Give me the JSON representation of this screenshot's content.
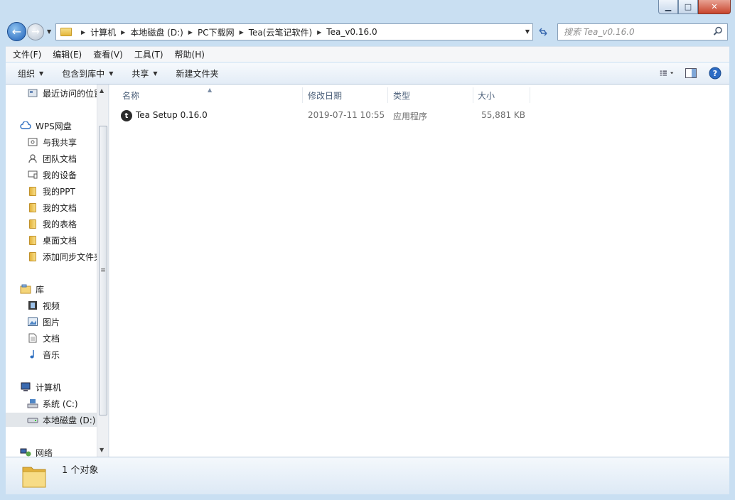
{
  "window": {
    "caption": {
      "minimize": "▁",
      "maximize": "□",
      "close": "✕"
    }
  },
  "address_bar": {
    "breadcrumbs": [
      "计算机",
      "本地磁盘 (D:)",
      "PC下载网",
      "Tea(云笔记软件)",
      "Tea_v0.16.0"
    ]
  },
  "search": {
    "placeholder": "搜索 Tea_v0.16.0"
  },
  "menubar": {
    "items": [
      "文件(F)",
      "编辑(E)",
      "查看(V)",
      "工具(T)",
      "帮助(H)"
    ]
  },
  "command_bar": {
    "organize": "组织",
    "include_in_library": "包含到库中",
    "share": "共享",
    "new_folder": "新建文件夹"
  },
  "nav_pane": {
    "recent": "最近访问的位置",
    "wps": "WPS网盘",
    "wps_children": [
      "与我共享",
      "团队文档",
      "我的设备",
      "我的PPT",
      "我的文档",
      "我的表格",
      "桌面文档",
      "添加同步文件夹"
    ],
    "library": "库",
    "library_children": [
      "视频",
      "图片",
      "文档",
      "音乐"
    ],
    "computer": "计算机",
    "computer_children": [
      "系统 (C:)",
      "本地磁盘 (D:)"
    ],
    "network": "网络"
  },
  "file_list": {
    "columns": [
      "名称",
      "修改日期",
      "类型",
      "大小"
    ],
    "rows": [
      {
        "name": "Tea Setup 0.16.0",
        "date": "2019-07-11 10:55",
        "type": "应用程序",
        "size": "55,881 KB",
        "icon": "t"
      }
    ]
  },
  "status": {
    "text": "1 个对象"
  },
  "colors": {
    "accent": "#1d5fb8",
    "chrome": "#c9dff2",
    "selection": "#e2e6ea"
  }
}
